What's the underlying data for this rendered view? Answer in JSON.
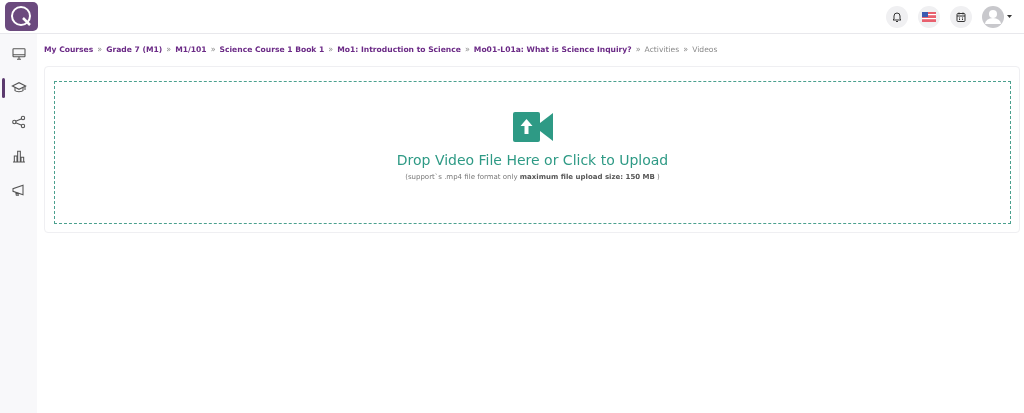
{
  "header": {
    "icons": [
      {
        "kind": "bell"
      },
      {
        "kind": "flag"
      },
      {
        "kind": "calendar"
      },
      {
        "kind": "avatar"
      }
    ]
  },
  "sidebar": {
    "items": [
      {
        "kind": "monitor",
        "selected": false
      },
      {
        "kind": "cap",
        "selected": true
      },
      {
        "kind": "share",
        "selected": false
      },
      {
        "kind": "chart",
        "selected": false
      },
      {
        "kind": "megaphone",
        "selected": false
      }
    ]
  },
  "breadcrumbs": [
    {
      "label": "My Courses",
      "kind": "link"
    },
    {
      "label": "Grade 7 (M1)",
      "kind": "link"
    },
    {
      "label": "M1/101",
      "kind": "link"
    },
    {
      "label": "Science Course 1 Book 1",
      "kind": "link"
    },
    {
      "label": "Mo1: Introduction to Science",
      "kind": "link"
    },
    {
      "label": "Mo01-L01a: What is Science Inquiry?",
      "kind": "link"
    },
    {
      "label": "Activities",
      "kind": "text"
    },
    {
      "label": "Videos",
      "kind": "text"
    }
  ],
  "separator": "»",
  "upload": {
    "title": "Drop Video File Here or Click to Upload",
    "hint": "(support`s .mp4 file format only **maximum file upload size: 150 MB** )"
  }
}
